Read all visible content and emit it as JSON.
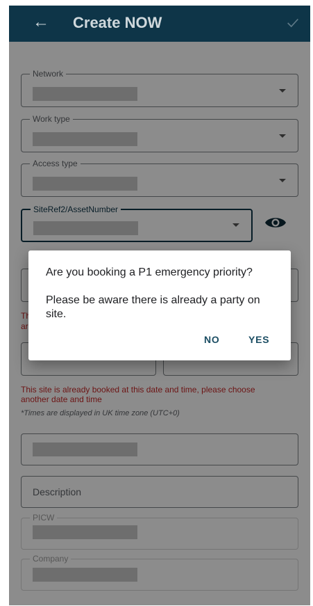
{
  "appbar": {
    "title": "Create NOW"
  },
  "fields": {
    "network": {
      "label": "Network"
    },
    "work_type": {
      "label": "Work type"
    },
    "access_type": {
      "label": "Access type"
    },
    "site_ref": {
      "label": "SiteRef2/AssetNumber"
    },
    "description": {
      "placeholder": "Description"
    },
    "picw": {
      "label": "PICW"
    },
    "company": {
      "label": "Company"
    }
  },
  "messages": {
    "booking_error": "This site is already booked at this date and time, please choose another date and time",
    "partial_error": "Th",
    "partial_error2": "ar",
    "timezone_hint": "*Times are displayed in UK time zone (UTC+0)"
  },
  "dialog": {
    "title": "Are you booking a P1 emergency priority?",
    "body": "Please be aware there is already a party on site.",
    "no_label": "NO",
    "yes_label": "YES"
  },
  "icons": {
    "back": "arrow-left-icon",
    "confirm": "check-icon",
    "visibility": "eye-icon",
    "dropdown": "caret-down-icon"
  },
  "colors": {
    "appbar": "#0e3548",
    "error": "#c62828",
    "dialog_button": "#1b4d63"
  }
}
